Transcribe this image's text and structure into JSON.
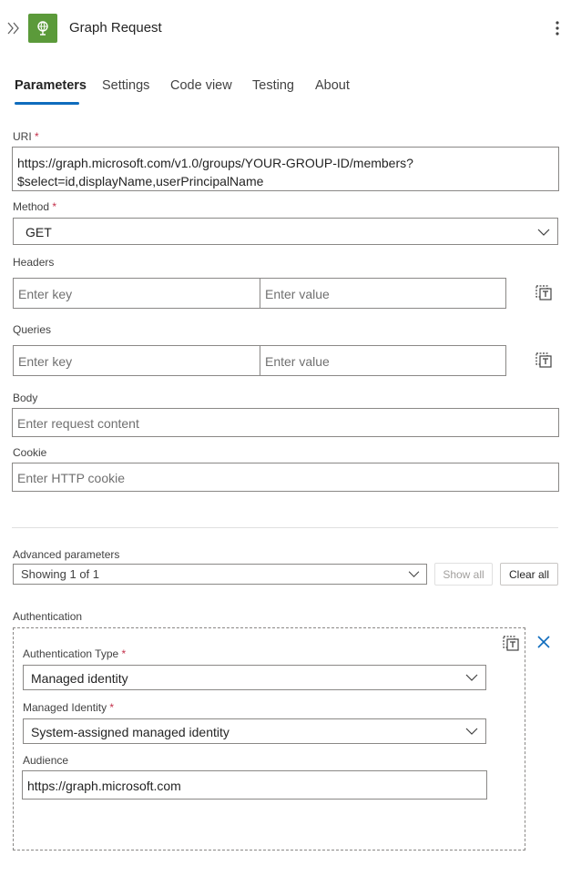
{
  "header": {
    "title": "Graph Request"
  },
  "tabs": [
    {
      "label": "Parameters",
      "active": true
    },
    {
      "label": "Settings"
    },
    {
      "label": "Code view"
    },
    {
      "label": "Testing"
    },
    {
      "label": "About"
    }
  ],
  "uri": {
    "label": "URI",
    "required_mark": "*",
    "value_line1": "https://graph.microsoft.com/v1.0/groups/YOUR-GROUP-ID/members?",
    "value_line2": "$select=id,displayName,userPrincipalName"
  },
  "method": {
    "label": "Method",
    "required_mark": "*",
    "value": "GET"
  },
  "headers": {
    "label": "Headers",
    "key_placeholder": "Enter key",
    "value_placeholder": "Enter value"
  },
  "queries": {
    "label": "Queries",
    "key_placeholder": "Enter key",
    "value_placeholder": "Enter value"
  },
  "body": {
    "label": "Body",
    "placeholder": "Enter request content"
  },
  "cookie": {
    "label": "Cookie",
    "placeholder": "Enter HTTP cookie"
  },
  "advanced": {
    "label": "Advanced parameters",
    "dropdown_value": "Showing 1 of 1",
    "show_all": "Show all",
    "clear_all": "Clear all"
  },
  "authentication": {
    "label": "Authentication",
    "type_label": "Authentication Type",
    "type_value": "Managed identity",
    "identity_label": "Managed Identity",
    "identity_value": "System-assigned managed identity",
    "audience_label": "Audience",
    "audience_value": "https://graph.microsoft.com",
    "required_mark": "*"
  },
  "colors": {
    "accent": "#0f6cbd",
    "app_icon_bg": "#5b9a3a",
    "required": "#c4314b"
  }
}
